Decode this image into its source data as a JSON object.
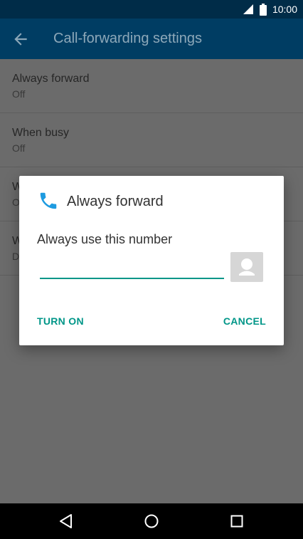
{
  "status_bar": {
    "time": "10:00"
  },
  "app_bar": {
    "title": "Call-forwarding settings"
  },
  "preferences": [
    {
      "title": "Always forward",
      "summary": "Off"
    },
    {
      "title": "When busy",
      "summary": "Off"
    },
    {
      "title": "W",
      "summary": "O"
    },
    {
      "title": "W",
      "summary": "D"
    }
  ],
  "dialog": {
    "title": "Always forward",
    "message": "Always use this number",
    "input_value": "",
    "turn_on_label": "TURN ON",
    "cancel_label": "CANCEL"
  },
  "colors": {
    "status_bar": "#002c48",
    "app_bar": "#003d63",
    "accent": "#009688",
    "phone_icon": "#1e9be0"
  },
  "icons": {
    "back": "arrow-left-icon",
    "dialog": "phone-icon",
    "contact": "contact-avatar-icon",
    "nav": [
      "back-triangle-icon",
      "home-circle-icon",
      "recents-square-icon"
    ]
  }
}
